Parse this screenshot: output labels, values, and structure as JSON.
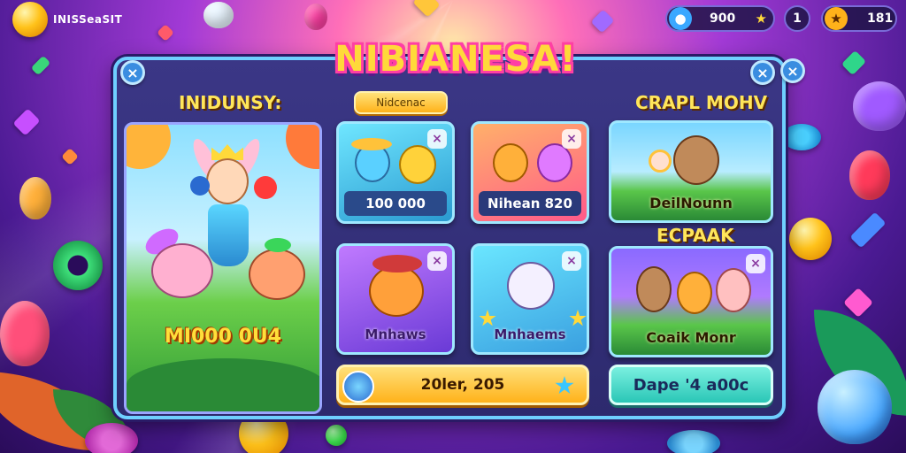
{
  "corner_text": "INISSeaSIT",
  "title": "NIBIANESA!",
  "hud": {
    "currency_value": "900",
    "level_value": "1",
    "gems_value": "181"
  },
  "sections": {
    "left_label": "INIDUNSY:",
    "right_top_label": "CRAPL MOHV",
    "right_mid_label": "ECPAAK"
  },
  "tab_pill": "Nidcenac",
  "hero": {
    "caption": "MI000 0U4"
  },
  "cards": [
    {
      "label": "100 000",
      "close": "×"
    },
    {
      "label": "Nihean 820",
      "close": "×"
    },
    {
      "label": "Mnhaws",
      "close": "×"
    },
    {
      "label": "Mnhaems",
      "close": "×"
    }
  ],
  "right_cards": [
    {
      "label": "DeilNounn"
    },
    {
      "label": "Coaik Monr",
      "close": "×"
    }
  ],
  "bottom": {
    "progress_label": "20ler, 205",
    "action_label": "Dape '4 a00c"
  },
  "icons": {
    "close": "close-icon",
    "star": "star-icon",
    "coin": "coin-icon",
    "gem": "gem-icon"
  },
  "colors": {
    "panel_border": "#6fd0ff",
    "title_fill": "#ffd93a",
    "title_outline": "#ff3fa4",
    "action_button": "#3ad6c6"
  }
}
